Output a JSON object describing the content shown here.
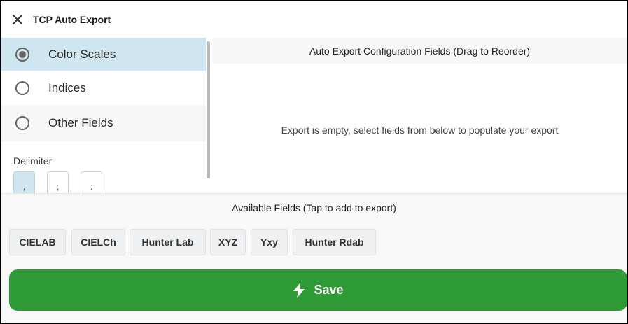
{
  "window": {
    "title": "TCP Auto Export",
    "close_icon": "close-icon"
  },
  "sidebar": {
    "options": [
      {
        "label": "Color Scales",
        "selected": true
      },
      {
        "label": "Indices",
        "selected": false
      },
      {
        "label": "Other Fields",
        "selected": false
      }
    ],
    "delimiter": {
      "label": "Delimiter",
      "options": [
        ",",
        ";",
        ":"
      ],
      "selected": ","
    }
  },
  "config": {
    "header": "Auto Export Configuration Fields (Drag to Reorder)",
    "empty_message": "Export is empty, select fields from below to populate your export"
  },
  "available": {
    "title": "Available Fields (Tap to add to export)",
    "fields": [
      "CIELAB",
      "CIELCh",
      "Hunter Lab",
      "XYZ",
      "Yxy",
      "Hunter Rdab"
    ]
  },
  "save": {
    "label": "Save",
    "icon": "lightning-bolt-icon",
    "color": "#2f9b36"
  },
  "colors": {
    "selected_row": "#cfe5ef"
  }
}
